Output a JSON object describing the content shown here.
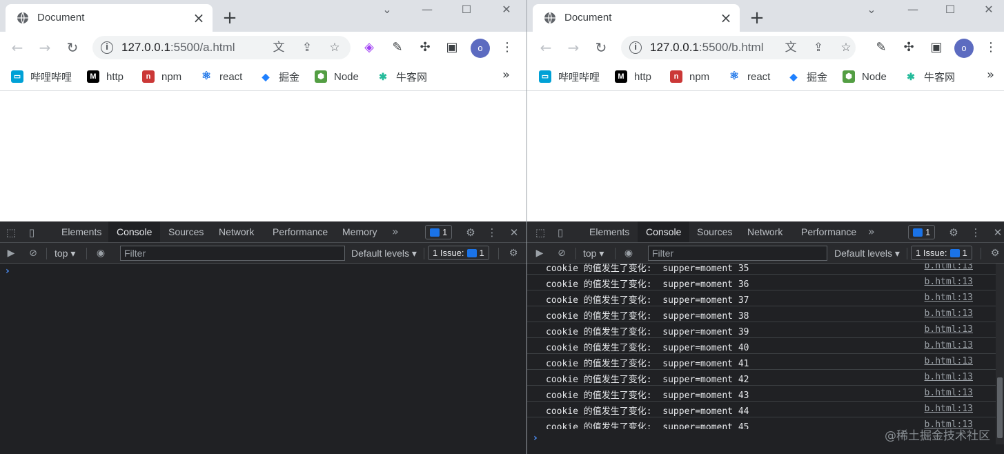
{
  "windows": [
    {
      "tab_title": "Document",
      "url_host": "127.0.0.1",
      "url_rest": ":5500/a.html",
      "avatar_letter": "o",
      "bookmarks": [
        "哔哩哔哩",
        "http",
        "npm",
        "react",
        "掘金",
        "Node",
        "牛客网"
      ],
      "devtools": {
        "tabs": [
          "Elements",
          "Console",
          "Sources",
          "Network",
          "Performance",
          "Memory"
        ],
        "active_tab": "Console",
        "issues_badge": "1",
        "context": "top",
        "filter_placeholder": "Filter",
        "levels": "Default levels",
        "issue_count_label": "1 Issue:",
        "issue_count": "1",
        "prompt": "›"
      }
    },
    {
      "tab_title": "Document",
      "url_host": "127.0.0.1",
      "url_rest": ":5500/b.html",
      "avatar_letter": "o",
      "bookmarks": [
        "哔哩哔哩",
        "http",
        "npm",
        "react",
        "掘金",
        "Node",
        "牛客网"
      ],
      "devtools": {
        "tabs": [
          "Elements",
          "Console",
          "Sources",
          "Network",
          "Performance"
        ],
        "active_tab": "Console",
        "issues_badge": "1",
        "context": "top",
        "filter_placeholder": "Filter",
        "levels": "Default levels",
        "issue_count_label": "1 Issue:",
        "issue_count": "1",
        "prompt": "›",
        "logs": [
          {
            "msg": "cookie 的值发生了变化:  supper=moment 35",
            "src": "b.html:13"
          },
          {
            "msg": "cookie 的值发生了变化:  supper=moment 36",
            "src": "b.html:13"
          },
          {
            "msg": "cookie 的值发生了变化:  supper=moment 37",
            "src": "b.html:13"
          },
          {
            "msg": "cookie 的值发生了变化:  supper=moment 38",
            "src": "b.html:13"
          },
          {
            "msg": "cookie 的值发生了变化:  supper=moment 39",
            "src": "b.html:13"
          },
          {
            "msg": "cookie 的值发生了变化:  supper=moment 40",
            "src": "b.html:13"
          },
          {
            "msg": "cookie 的值发生了变化:  supper=moment 41",
            "src": "b.html:13"
          },
          {
            "msg": "cookie 的值发生了变化:  supper=moment 42",
            "src": "b.html:13"
          },
          {
            "msg": "cookie 的值发生了变化:  supper=moment 43",
            "src": "b.html:13"
          },
          {
            "msg": "cookie 的值发生了变化:  supper=moment 44",
            "src": "b.html:13"
          },
          {
            "msg": "cookie 的值发生了变化:  supper=moment 45",
            "src": "b.html:13"
          }
        ]
      }
    }
  ],
  "watermark": "@稀土掘金技术社区",
  "colors": {
    "bilibili": "#00a1d6",
    "npm": "#cb3837",
    "react": "#61dafb",
    "juejin": "#1e80ff",
    "node": "#539e43",
    "nowcoder": "#25bb9b",
    "notion_bg": "#000000",
    "issue_blue": "#1a73e8"
  }
}
